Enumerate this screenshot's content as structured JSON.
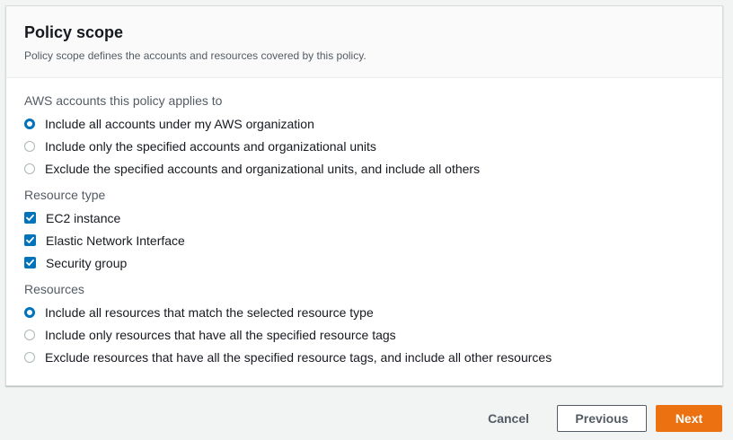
{
  "panel": {
    "title": "Policy scope",
    "description": "Policy scope defines the accounts and resources covered by this policy."
  },
  "accounts": {
    "label": "AWS accounts this policy applies to",
    "options": [
      {
        "label": "Include all accounts under my AWS organization",
        "selected": true
      },
      {
        "label": "Include only the specified accounts and organizational units",
        "selected": false
      },
      {
        "label": "Exclude the specified accounts and organizational units, and include all others",
        "selected": false
      }
    ]
  },
  "resource_type": {
    "label": "Resource type",
    "options": [
      {
        "label": "EC2 instance",
        "checked": true
      },
      {
        "label": "Elastic Network Interface",
        "checked": true
      },
      {
        "label": "Security group",
        "checked": true
      }
    ]
  },
  "resources": {
    "label": "Resources",
    "options": [
      {
        "label": "Include all resources that match the selected resource type",
        "selected": true
      },
      {
        "label": "Include only resources that have all the specified resource tags",
        "selected": false
      },
      {
        "label": "Exclude resources that have all the specified resource tags, and include all other resources",
        "selected": false
      }
    ]
  },
  "footer": {
    "cancel_label": "Cancel",
    "previous_label": "Previous",
    "next_label": "Next"
  },
  "colors": {
    "primary_blue": "#0073bb",
    "accent_orange": "#ec7211",
    "text_secondary": "#545b64"
  }
}
